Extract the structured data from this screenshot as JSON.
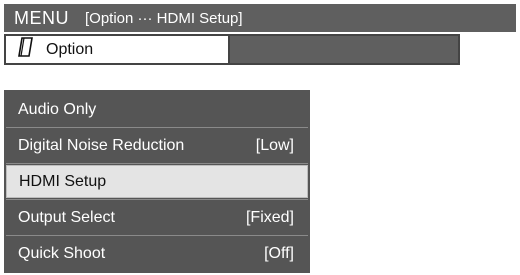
{
  "header": {
    "title": "MENU",
    "path": "[Option ··· HDMI Setup]"
  },
  "option_tab": {
    "icon": "document-icon",
    "label": "Option"
  },
  "menu": {
    "items": [
      {
        "label": "Audio Only",
        "value": ""
      },
      {
        "label": "Digital Noise Reduction",
        "value": "[Low]"
      },
      {
        "label": "HDMI Setup",
        "value": ""
      },
      {
        "label": "Output Select",
        "value": "[Fixed]"
      },
      {
        "label": "Quick Shoot",
        "value": "[Off]"
      }
    ],
    "selected_index": 2
  },
  "colors": {
    "bar": "#5f5f5f",
    "list": "#555555",
    "highlight": "#e4e4e4"
  }
}
